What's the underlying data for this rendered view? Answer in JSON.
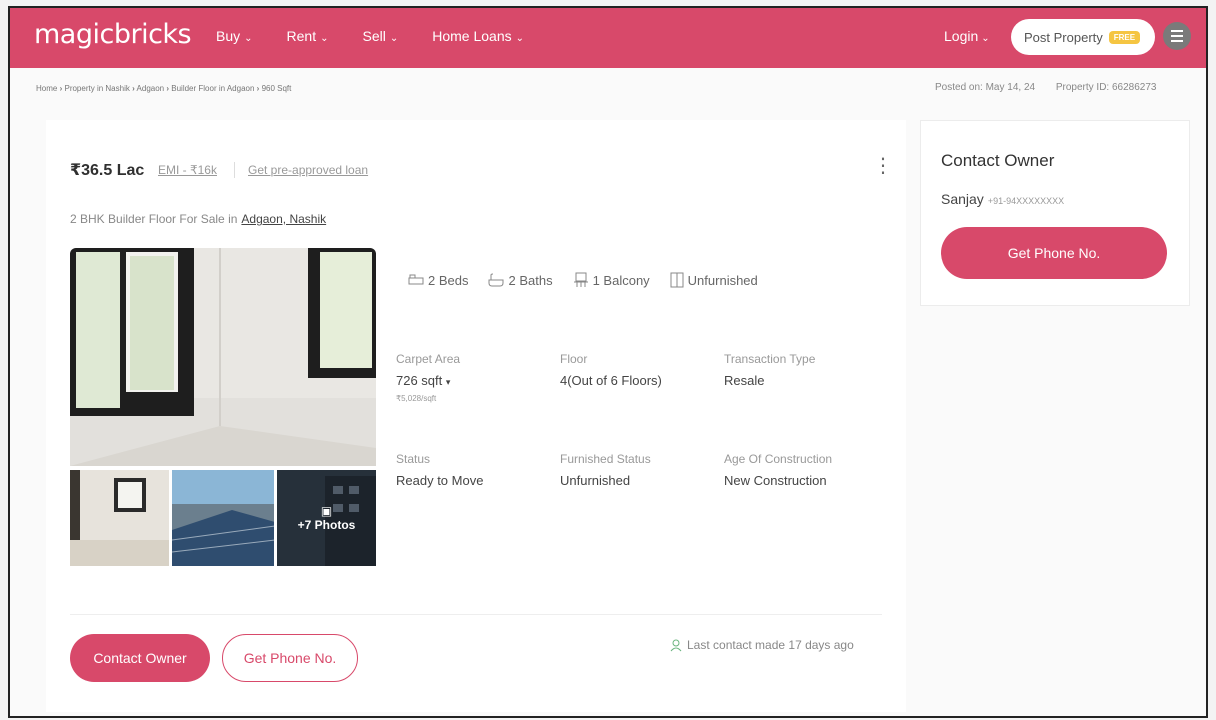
{
  "brand": {
    "logo": "magicbricks",
    "accent": "#d8496a"
  },
  "nav": {
    "items": [
      {
        "label": "Buy"
      },
      {
        "label": "Rent"
      },
      {
        "label": "Sell"
      },
      {
        "label": "Home Loans"
      }
    ],
    "login": "Login",
    "post_property": "Post Property",
    "free_badge": "FREE"
  },
  "breadcrumb": {
    "items": [
      "Home",
      "Property in Nashik",
      "Adgaon",
      "Builder Floor in Adgaon",
      "960 Sqft"
    ],
    "separator": "›"
  },
  "meta": {
    "posted_on": "Posted on: May 14, 24",
    "property_id": "Property ID: 66286273"
  },
  "listing": {
    "price": "₹36.5 Lac",
    "emi": "EMI - ₹16k",
    "preapproved": "Get pre-approved loan",
    "title_prefix": "2 BHK Builder Floor For Sale in",
    "location": "Adgaon, Nashik",
    "more_photos": "+7 Photos",
    "features": [
      {
        "icon": "bed-icon",
        "label": "2 Beds"
      },
      {
        "icon": "bath-icon",
        "label": "2 Baths"
      },
      {
        "icon": "balcony-icon",
        "label": "1 Balcony"
      },
      {
        "icon": "furnishing-icon",
        "label": "Unfurnished"
      }
    ],
    "summary": {
      "carpet_area": {
        "label": "Carpet Area",
        "value": "726 sqft",
        "sub": "₹5,028/sqft"
      },
      "floor": {
        "label": "Floor",
        "value": "4(Out of 6 Floors)"
      },
      "transaction": {
        "label": "Transaction Type",
        "value": "Resale"
      },
      "status": {
        "label": "Status",
        "value": "Ready to Move"
      },
      "furnished": {
        "label": "Furnished Status",
        "value": "Unfurnished"
      },
      "age": {
        "label": "Age Of Construction",
        "value": "New Construction"
      }
    },
    "contact_owner_button": "Contact Owner",
    "get_phone_button": "Get Phone No.",
    "last_contact": "Last contact made 17 days ago"
  },
  "contact_box": {
    "title": "Contact Owner",
    "owner_name": "Sanjay",
    "owner_phone": "+91-94XXXXXXXX",
    "button": "Get Phone No."
  }
}
